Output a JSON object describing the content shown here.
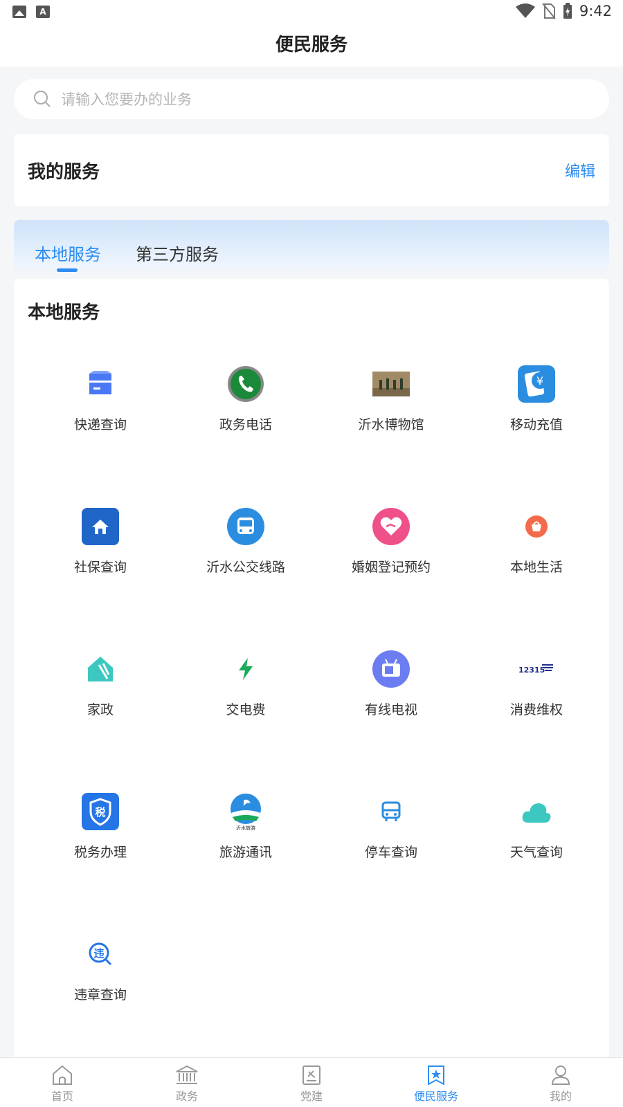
{
  "status_bar": {
    "time": "9:42"
  },
  "header": {
    "title": "便民服务"
  },
  "search": {
    "placeholder": "请输入您要办的业务"
  },
  "my_services": {
    "title": "我的服务",
    "edit_label": "编辑"
  },
  "tabs": [
    {
      "label": "本地服务",
      "active": true
    },
    {
      "label": "第三方服务",
      "active": false
    }
  ],
  "local_services": {
    "title": "本地服务",
    "items": [
      {
        "label": "快递查询",
        "icon": "package-icon"
      },
      {
        "label": "政务电话",
        "icon": "phone-icon"
      },
      {
        "label": "沂水博物馆",
        "icon": "museum-icon"
      },
      {
        "label": "移动充值",
        "icon": "mobile-recharge-icon"
      },
      {
        "label": "社保查询",
        "icon": "social-security-icon"
      },
      {
        "label": "沂水公交线路",
        "icon": "bus-icon"
      },
      {
        "label": "婚姻登记预约",
        "icon": "heart-icon"
      },
      {
        "label": "本地生活",
        "icon": "basket-icon"
      },
      {
        "label": "家政",
        "icon": "housekeeping-icon"
      },
      {
        "label": "交电费",
        "icon": "lightning-icon"
      },
      {
        "label": "有线电视",
        "icon": "tv-icon"
      },
      {
        "label": "消费维权",
        "icon": "consumer-rights-icon",
        "badge": "12315"
      },
      {
        "label": "税务办理",
        "icon": "tax-shield-icon",
        "badge": "税"
      },
      {
        "label": "旅游通讯",
        "icon": "tourism-logo-icon",
        "badge": "沂水旅游"
      },
      {
        "label": "停车查询",
        "icon": "parking-bus-icon"
      },
      {
        "label": "天气查询",
        "icon": "cloud-icon"
      },
      {
        "label": "违章查询",
        "icon": "violation-search-icon",
        "badge": "违"
      }
    ]
  },
  "bottom_nav": [
    {
      "label": "首页",
      "icon": "home-icon",
      "active": false
    },
    {
      "label": "政务",
      "icon": "government-icon",
      "active": false
    },
    {
      "label": "党建",
      "icon": "party-building-icon",
      "active": false
    },
    {
      "label": "便民服务",
      "icon": "star-bookmark-icon",
      "active": true
    },
    {
      "label": "我的",
      "icon": "user-icon",
      "active": false
    }
  ],
  "colors": {
    "accent": "#2d8cf0",
    "background": "#f5f6f8"
  }
}
